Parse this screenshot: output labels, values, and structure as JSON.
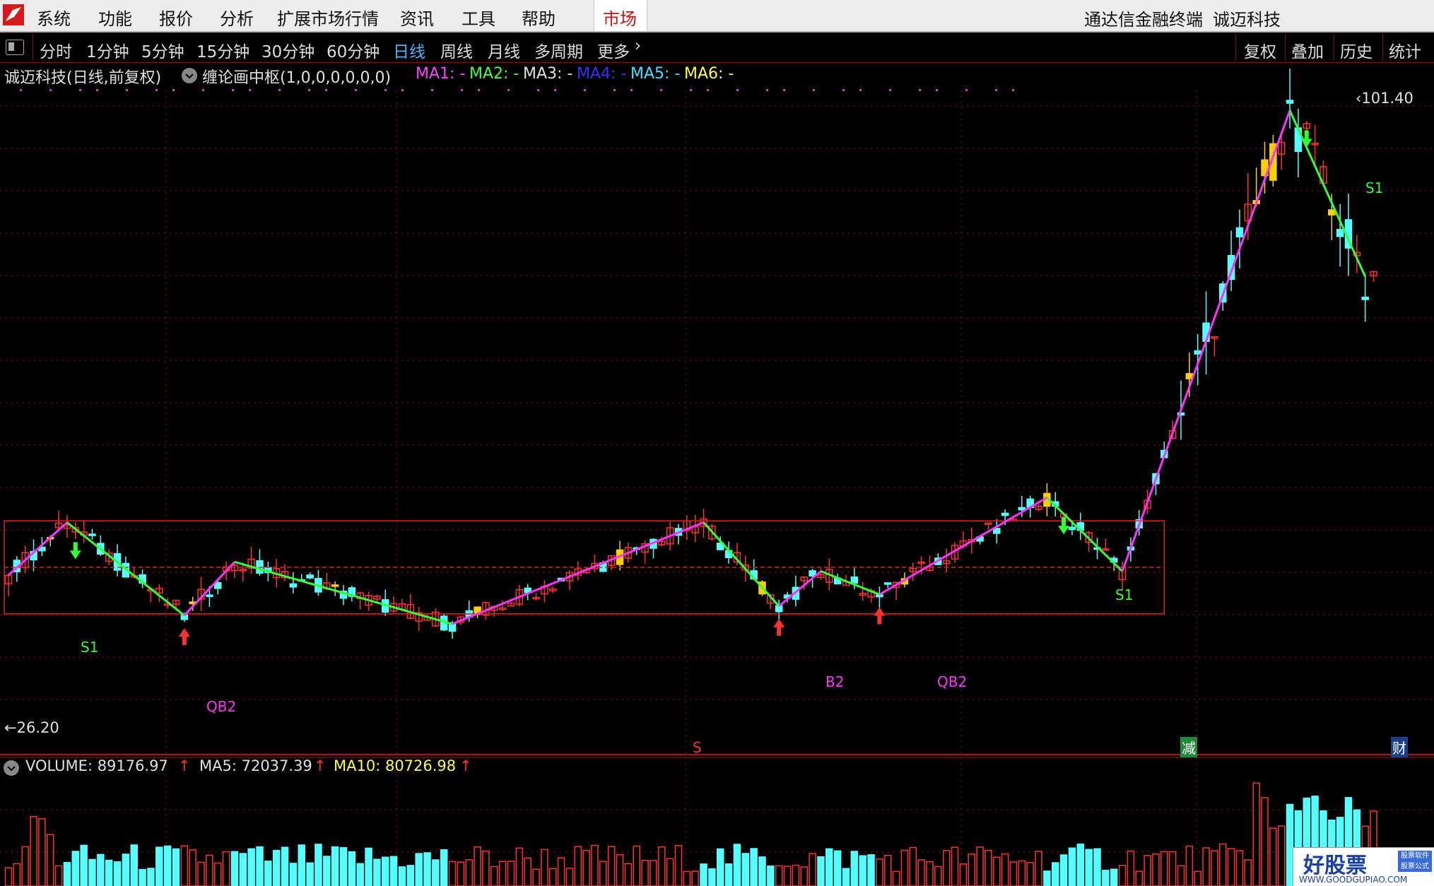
{
  "menubar": {
    "items": [
      "系统",
      "功能",
      "报价",
      "分析",
      "扩展市场行情",
      "资讯",
      "工具",
      "帮助"
    ],
    "market_tab": "市场",
    "app_name": "通达信金融终端",
    "stock_name": "诚迈科技"
  },
  "periodbar": {
    "periods": [
      "分时",
      "1分钟",
      "5分钟",
      "15分钟",
      "30分钟",
      "60分钟",
      "日线",
      "周线",
      "月线",
      "多周期",
      "更多"
    ],
    "active": "日线",
    "tools": [
      "复权",
      "叠加",
      "历史",
      "统计"
    ]
  },
  "chart_header": {
    "title": "诚迈科技(日线,前复权)",
    "indicator": "缠论画中枢(1,0,0,0,0,0,0)",
    "ma_labels": [
      {
        "text": "MA1: -",
        "color": "#ff40ff"
      },
      {
        "text": "MA2: -",
        "color": "#40ff40"
      },
      {
        "text": "MA3: -",
        "color": "#e0e0e0"
      },
      {
        "text": "MA4: -",
        "color": "#3030ff"
      },
      {
        "text": "MA5: -",
        "color": "#40e0ff"
      },
      {
        "text": "MA6: -",
        "color": "#ffff40"
      }
    ]
  },
  "price_labels": {
    "high": "101.40",
    "low": "26.20"
  },
  "signals": {
    "qb2_a": "QB2",
    "qb2_b": "QB2",
    "b2": "B2",
    "s1_a": "S1",
    "s1_b": "S1",
    "s1_c": "S1"
  },
  "badges": {
    "s_mark": "S",
    "reduce": "减",
    "finance": "财"
  },
  "volume_header": {
    "volume_label": "VOLUME: 89176.97",
    "ma5_label": "MA5: 72037.39",
    "ma10_label": "MA10: 80726.98"
  },
  "watermark": {
    "main": "好股票",
    "url": "WWW.GOODGUPIAO.COM",
    "side": "股票软件 股票公式"
  },
  "colors": {
    "up": "#ff3030",
    "down": "#54ffff",
    "bi_up": "#ff30ff",
    "bi_down": "#30ff30",
    "zhongshu": "#e02020",
    "highlight": "#ffd000"
  },
  "chart_data": {
    "type": "candlestick",
    "y_range": [
      26.2,
      101.4
    ],
    "price_high": 101.4,
    "price_low": 26.2,
    "zhongshu_box": {
      "high": 48.5,
      "mid": 42.5,
      "low": 36.5
    },
    "bi_pivots": [
      {
        "i": 0,
        "p": 41.5
      },
      {
        "i": 7,
        "p": 48.3
      },
      {
        "i": 21,
        "p": 36.3
      },
      {
        "i": 27,
        "p": 43.2
      },
      {
        "i": 53,
        "p": 35.2
      },
      {
        "i": 83,
        "p": 48.3
      },
      {
        "i": 92,
        "p": 37.5
      },
      {
        "i": 97,
        "p": 42.0
      },
      {
        "i": 104,
        "p": 39.0
      },
      {
        "i": 124,
        "p": 51.5
      },
      {
        "i": 133,
        "p": 42.0
      },
      {
        "i": 153,
        "p": 101.4
      },
      {
        "i": 162,
        "p": 80.0
      }
    ],
    "volume_series": [
      {
        "name": "VOLUME",
        "value": 89176.97
      },
      {
        "name": "MA5",
        "value": 72037.39
      },
      {
        "name": "MA10",
        "value": 80726.98
      }
    ]
  }
}
